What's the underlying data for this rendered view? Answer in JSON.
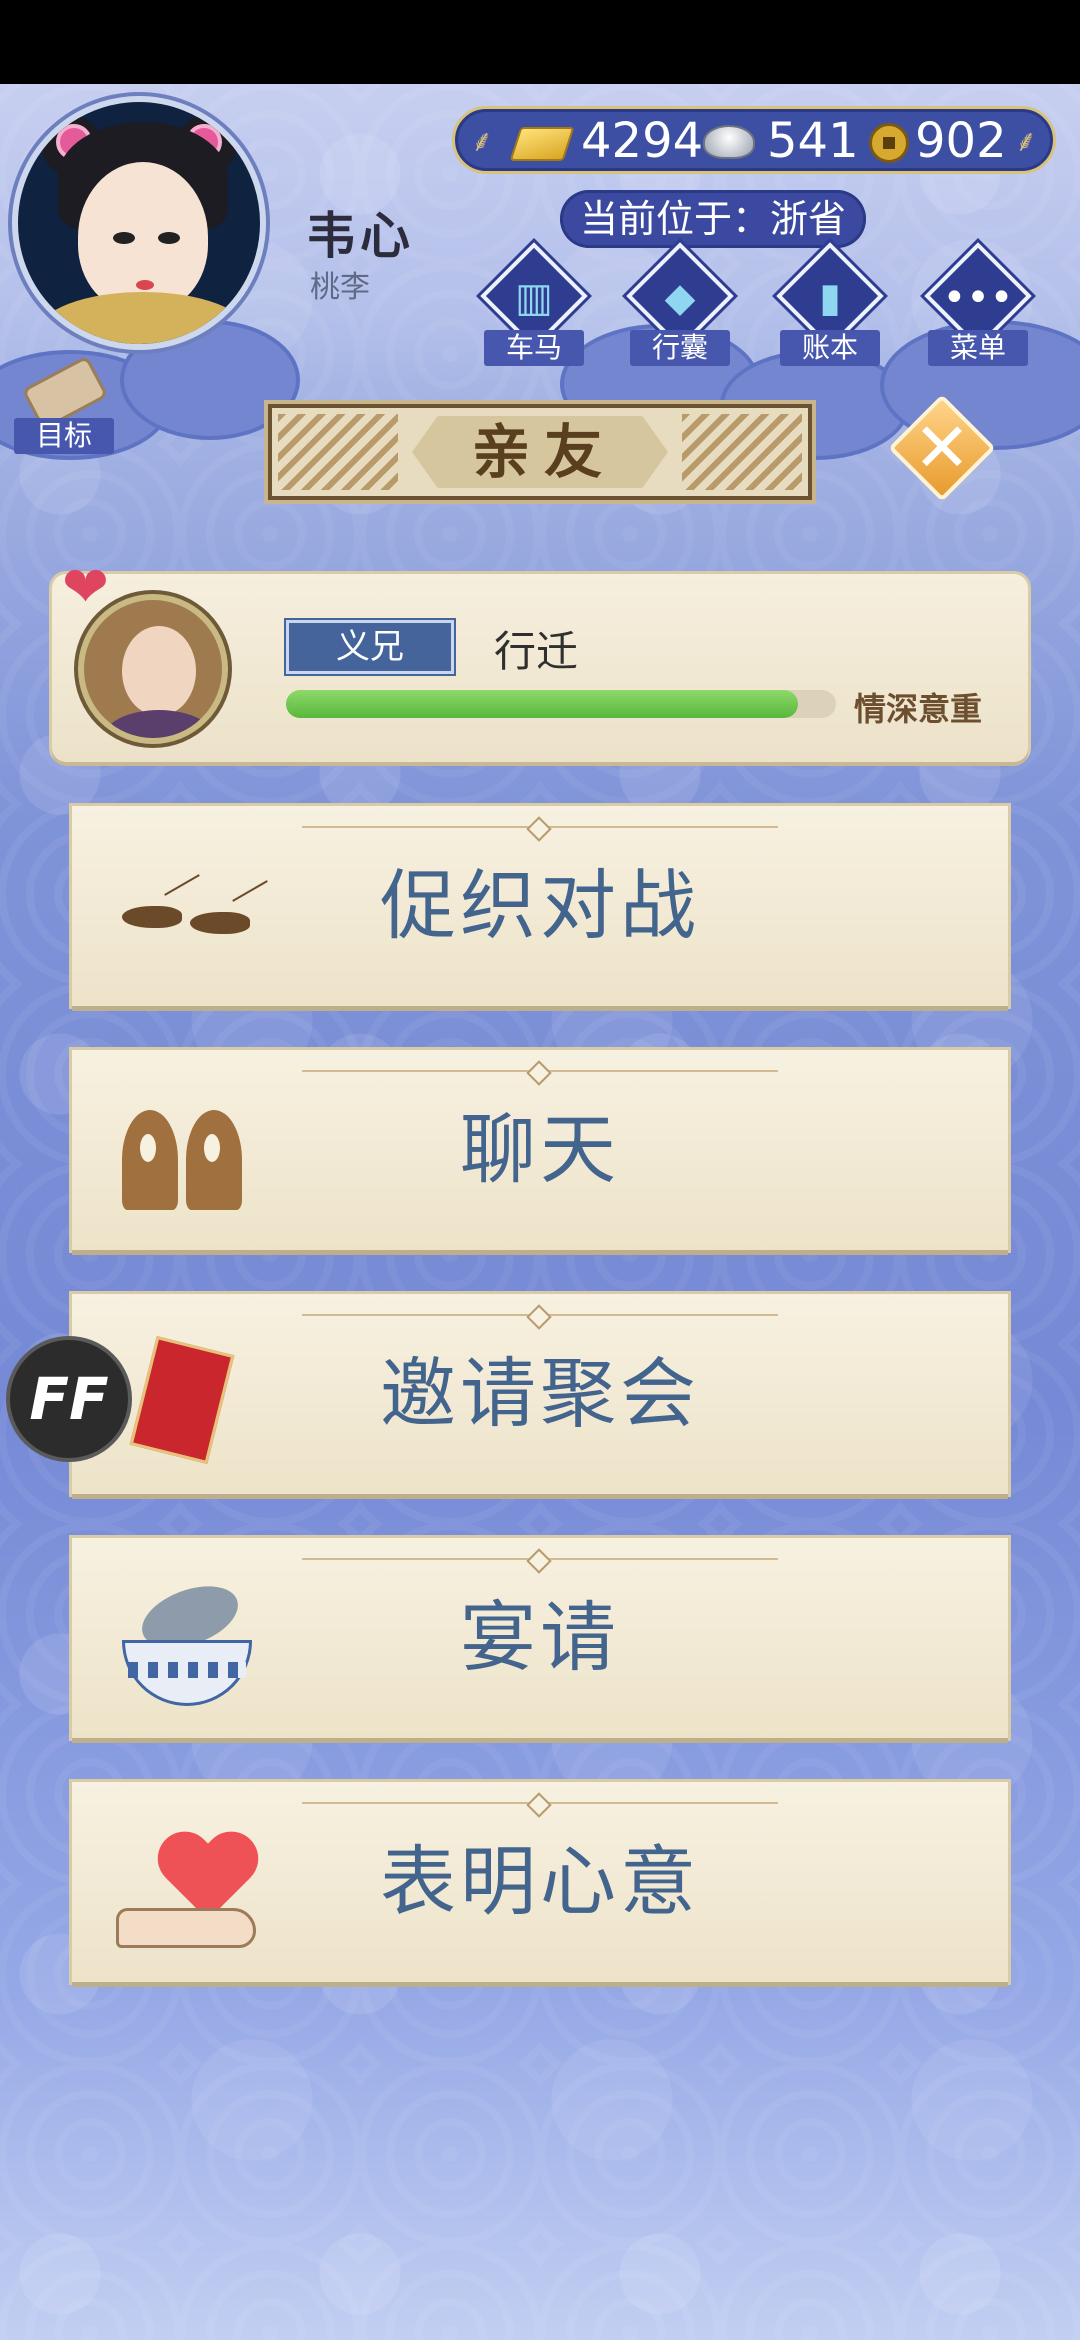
{
  "player": {
    "name": "韦心",
    "subtitle": "桃李"
  },
  "currency": {
    "gold": "4294",
    "silver": "541",
    "coins": "902"
  },
  "location": {
    "text": "当前位于：浙省"
  },
  "nav": [
    {
      "label": "车马",
      "icon": "carriage-icon"
    },
    {
      "label": "行囊",
      "icon": "bundle-icon"
    },
    {
      "label": "账本",
      "icon": "ledger-icon"
    },
    {
      "label": "菜单",
      "icon": "menu-dots-icon"
    }
  ],
  "goal": {
    "label": "目标"
  },
  "panel": {
    "title": "亲友"
  },
  "friend": {
    "relation": "义兄",
    "name": "行迁",
    "affection_level": 0.93,
    "status": "情深意重"
  },
  "actions": [
    {
      "label": "促织对战",
      "icon": "cricket-icon"
    },
    {
      "label": "聊天",
      "icon": "chat-icon"
    },
    {
      "label": "邀请聚会",
      "icon": "invitation-icon"
    },
    {
      "label": "宴请",
      "icon": "banquet-bowl-icon"
    },
    {
      "label": "表明心意",
      "icon": "heart-hand-icon"
    }
  ],
  "floating": {
    "label": "FF"
  },
  "colors": {
    "accent_blue": "#43648c",
    "header_navy": "#3c4fa2",
    "progress_green": "#58b83c",
    "close_orange": "#e89a2d"
  }
}
